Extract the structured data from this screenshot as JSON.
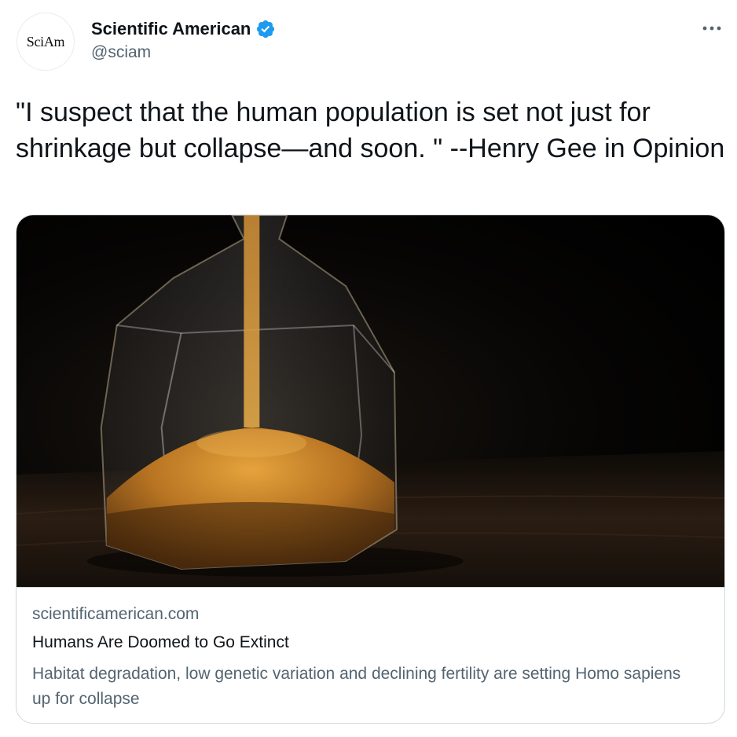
{
  "author": {
    "display_name": "Scientific American",
    "handle": "@sciam",
    "avatar_text": "SciAm",
    "verified": true
  },
  "tweet": {
    "text": "\"I suspect that the human population is set not just for shrinkage but collapse—and soon. \" --Henry Gee in Opinion"
  },
  "card": {
    "image_icon": "hourglass-image",
    "domain": "scientificamerican.com",
    "title": "Humans Are Doomed to Go Extinct",
    "description": "Habitat degradation, low genetic variation and declining fertility are setting Homo sapiens up for collapse"
  },
  "colors": {
    "verified_blue": "#1d9bf0",
    "secondary_text": "#536471",
    "primary_text": "#0f1419",
    "border": "#cfd9de"
  }
}
